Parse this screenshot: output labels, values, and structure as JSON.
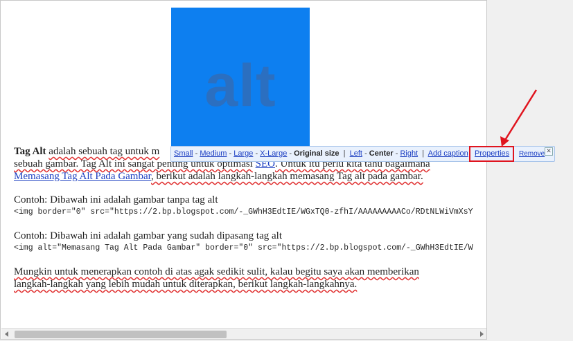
{
  "image": {
    "text": "alt",
    "bg_color": "#0d7ff0"
  },
  "content": {
    "line1_bold": "Tag Alt",
    "line1_rest": "adalah sebuah tag untuk m",
    "line2_a": "sebuah gambar. Tag Alt ini sangat penting untuk optimasi",
    "line2_link": "SEO",
    "line2_b": ". Untuk itu perlu kita tahu bagaimana",
    "line3_link": "Memasang Tag Alt Pada Gambar",
    "line3_rest": ", berikut adalah langkah-langkah memasang Tag alt pada gambar.",
    "example1_label": "Contoh: Dibawah ini adalah gambar tanpa tag alt",
    "example1_code": "<img border=\"0\" src=\"https://2.bp.blogspot.com/-_GWhH3EdtIE/WGxTQ0-zfhI/AAAAAAAAACo/RDtNLWiVmXsY",
    "example2_label": "Contoh: Dibawah ini adalah gambar yang sudah dipasang tag alt",
    "example2_code": "<img alt=\"Memasang Tag Alt Pada Gambar\" border=\"0\" src=\"https://2.bp.blogspot.com/-_GWhH3EdtIE/W",
    "para_last_1": "Mungkin untuk menerapkan contoh di atas agak sedikit sulit, kalau begitu saya akan memberikan",
    "para_last_2": "langkah-langkah yang lebih mudah untuk diterapkan, berikut langkah-langkahnya."
  },
  "toolbar": {
    "small": "Small",
    "medium": "Medium",
    "large": "Large",
    "xlarge": "X-Large",
    "original": "Original size",
    "left": "Left",
    "center": "Center",
    "right": "Right",
    "add_caption": "Add caption",
    "properties": "Properties",
    "remove": "Remove",
    "dash": "-",
    "bar": "|"
  },
  "colors": {
    "highlight": "#e0141e",
    "link": "#1a3dc1"
  }
}
